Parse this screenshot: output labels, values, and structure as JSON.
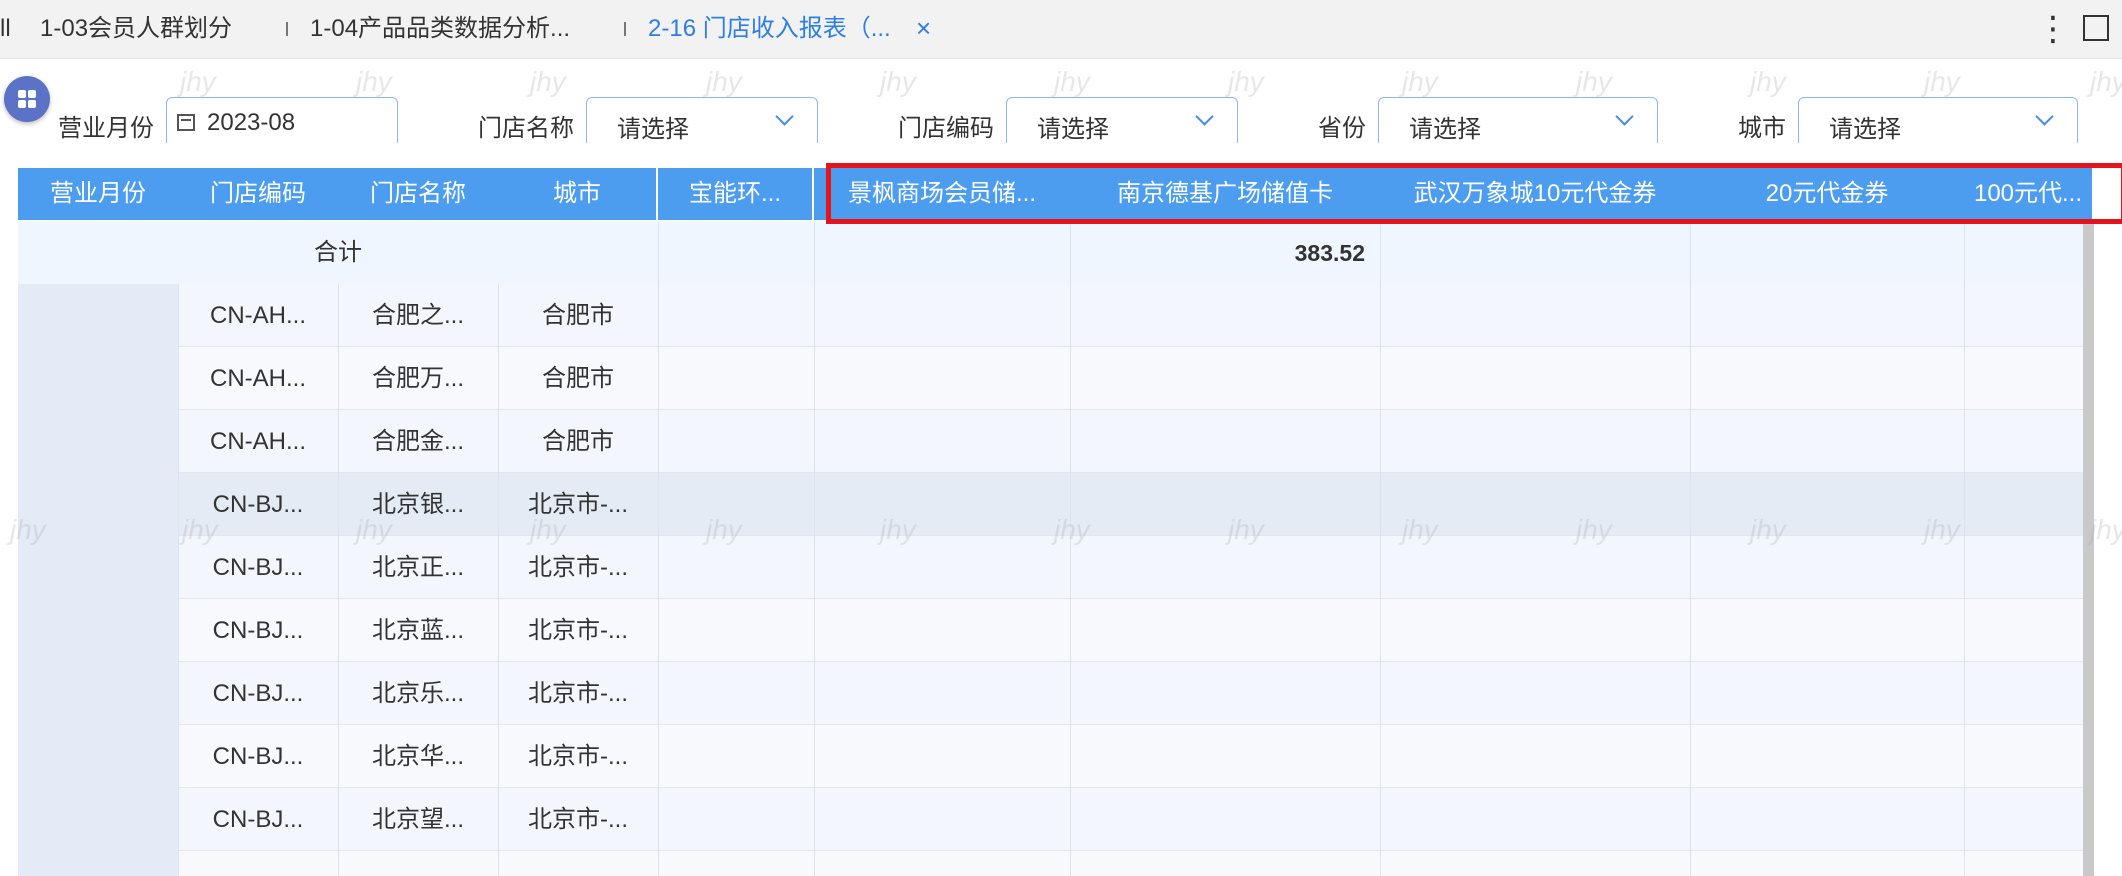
{
  "tabs": [
    {
      "label": "ll"
    },
    {
      "label": "1-03会员人群划分"
    },
    {
      "label": "1-04产品品类数据分析..."
    },
    {
      "label": "2-16 门店收入报表（..."
    }
  ],
  "tab_close": "×",
  "window_menu": "⋮",
  "filters": {
    "month_label": "营业月份",
    "month_value": "2023-08",
    "store_name_label": "门店名称",
    "store_name_value": "请选择",
    "store_code_label": "门店编码",
    "store_code_value": "请选择",
    "province_label": "省份",
    "province_value": "请选择",
    "city_label": "城市",
    "city_value": "请选择"
  },
  "table": {
    "headers": [
      "营业月份",
      "门店编码",
      "门店名称",
      "城市",
      "宝能环...",
      "景枫商场会员储...",
      "南京德基广场储值卡",
      "武汉万象城10元代金券",
      "20元代金券",
      "100元代..."
    ],
    "total_label": "合计",
    "total_value": "383.52",
    "rows": [
      [
        "CN-AH...",
        "合肥之...",
        "合肥市"
      ],
      [
        "CN-AH...",
        "合肥万...",
        "合肥市"
      ],
      [
        "CN-AH...",
        "合肥金...",
        "合肥市"
      ],
      [
        "CN-BJ...",
        "北京银...",
        "北京市-..."
      ],
      [
        "CN-BJ...",
        "北京正...",
        "北京市-..."
      ],
      [
        "CN-BJ...",
        "北京蓝...",
        "北京市-..."
      ],
      [
        "CN-BJ...",
        "北京乐...",
        "北京市-..."
      ],
      [
        "CN-BJ...",
        "北京华...",
        "北京市-..."
      ],
      [
        "CN-BJ...",
        "北京望...",
        "北京市-..."
      ]
    ]
  },
  "watermark": "jhy",
  "colors": {
    "header_bg": "#4c9cf0",
    "accent": "#2e7de6",
    "highlight_box": "#e5131b"
  }
}
